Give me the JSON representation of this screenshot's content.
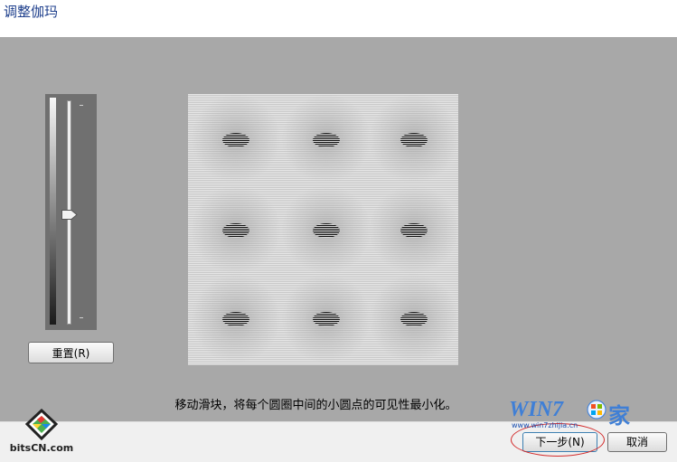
{
  "title": "调整伽玛",
  "reset_label": "重置(R)",
  "instruction": "移动滑块，将每个圆圈中间的小圆点的可见性最小化。",
  "next_label": "下一步(N)",
  "cancel_label": "取消",
  "slider": {
    "value_fraction": 0.52
  },
  "watermark_left": "bitsCN.com",
  "watermark_right": {
    "word": "WIN7",
    "char": "家",
    "url": "www.win7zhijia.cn"
  },
  "colors": {
    "panel": "#a8a8a8",
    "title": "#1e3f8c",
    "annotation": "#d32b2b"
  }
}
